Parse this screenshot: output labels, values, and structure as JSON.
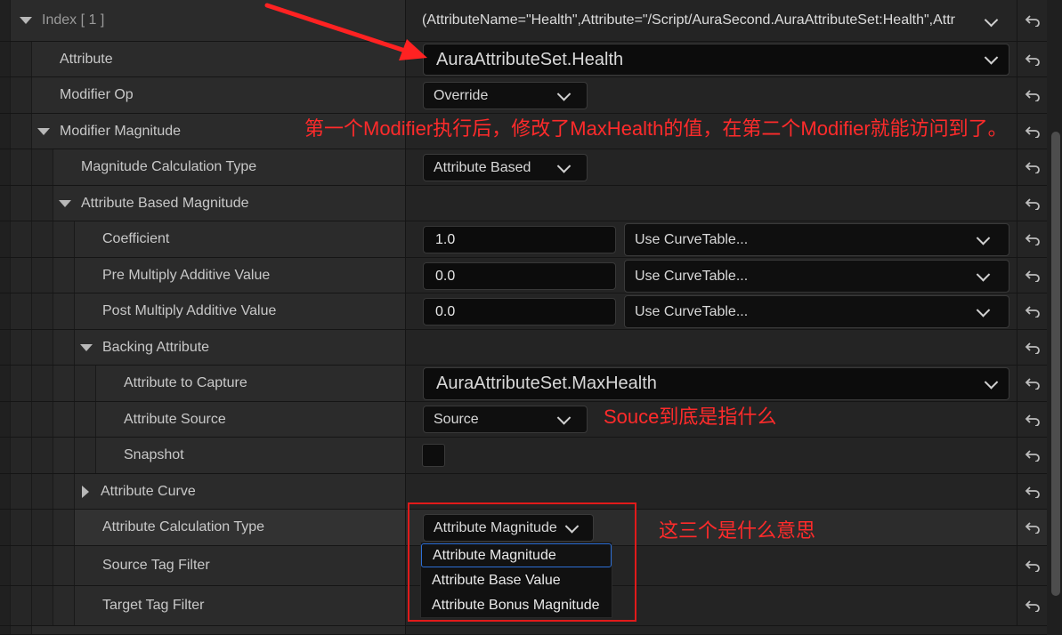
{
  "header": {
    "index_label": "Index [ 1 ]",
    "summary": "(AttributeName=\"Health\",Attribute=\"/Script/AuraSecond.AuraAttributeSet:Health\",Attri"
  },
  "rows": {
    "attribute": {
      "label": "Attribute",
      "value": "AuraAttributeSet.Health"
    },
    "modifier_op": {
      "label": "Modifier Op",
      "value": "Override"
    },
    "modifier_magnitude": {
      "label": "Modifier Magnitude"
    },
    "magnitude_calc_type": {
      "label": "Magnitude Calculation Type",
      "value": "Attribute Based"
    },
    "attribute_based_magnitude": {
      "label": "Attribute Based Magnitude"
    },
    "coefficient": {
      "label": "Coefficient",
      "value": "1.0",
      "curve": "Use CurveTable..."
    },
    "pre_multiply": {
      "label": "Pre Multiply Additive Value",
      "value": "0.0",
      "curve": "Use CurveTable..."
    },
    "post_multiply": {
      "label": "Post Multiply Additive Value",
      "value": "0.0",
      "curve": "Use CurveTable..."
    },
    "backing_attribute": {
      "label": "Backing Attribute"
    },
    "attribute_to_capture": {
      "label": "Attribute to Capture",
      "value": "AuraAttributeSet.MaxHealth"
    },
    "attribute_source": {
      "label": "Attribute Source",
      "value": "Source"
    },
    "snapshot": {
      "label": "Snapshot",
      "checked": false
    },
    "attribute_curve": {
      "label": "Attribute Curve"
    },
    "attribute_calc_type": {
      "label": "Attribute Calculation Type",
      "value": "Attribute Magnitude"
    },
    "source_tag_filter": {
      "label": "Source Tag Filter"
    },
    "target_tag_filter": {
      "label": "Target Tag Filter"
    }
  },
  "dropdown_options": [
    "Attribute Magnitude",
    "Attribute Base Value",
    "Attribute Bonus Magnitude"
  ],
  "annotations": {
    "note1": "第一个Modifier执行后，修改了MaxHealth的值，在第二个Modifier就能访问到了。",
    "note2": "Souce到底是指什么",
    "note3": "这三个是什么意思"
  },
  "colors": {
    "annotation": "#ff2b2b",
    "selection": "#2d6fd6"
  }
}
